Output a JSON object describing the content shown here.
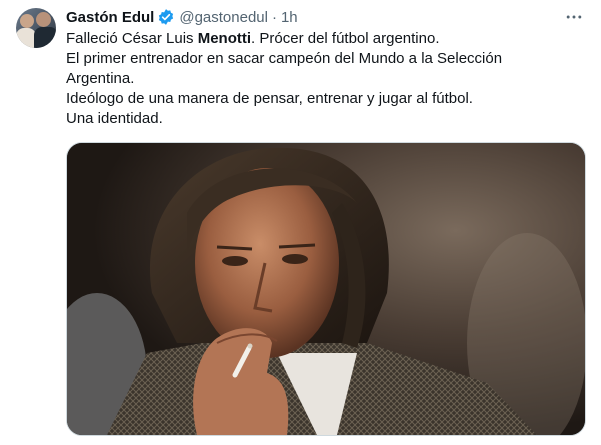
{
  "author": {
    "name": "Gastón Edul",
    "handle": "@gastonedul",
    "separator": "·",
    "time": "1h"
  },
  "icons": {
    "verified": "verified-badge-icon",
    "more": "more-options-icon",
    "accent_color": "#1d9bf0"
  },
  "tweet": {
    "line1_pre": "Falleció César Luis ",
    "line1_bold": "Menotti",
    "line1_post": ". Prócer del fútbol argentino.",
    "line2": "El primer entrenador en sacar campeón del Mundo a la Selección",
    "line3": "Argentina.",
    "line4": "Ideólogo de una manera de pensar, entrenar y jugar al fútbol.",
    "line5": "Una identidad."
  }
}
